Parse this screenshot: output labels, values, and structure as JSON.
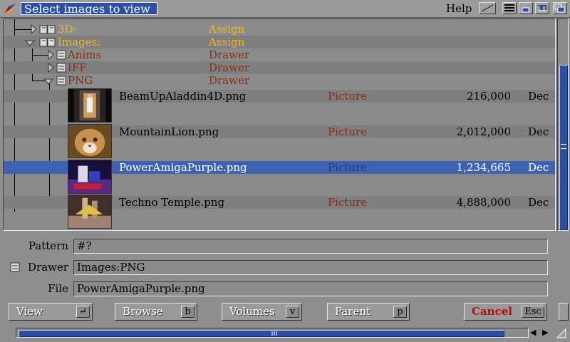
{
  "window": {
    "title": "Select images to view",
    "help_label": "Help"
  },
  "tree": [
    {
      "name": "3D:",
      "type": "Assign",
      "kind": "assign"
    },
    {
      "name": "Images:",
      "type": "Assign",
      "kind": "assign"
    },
    {
      "name": "Anims",
      "type": "Drawer",
      "kind": "drawer"
    },
    {
      "name": "IFF",
      "type": "Drawer",
      "kind": "drawer"
    },
    {
      "name": "PNG",
      "type": "Drawer",
      "kind": "drawer"
    }
  ],
  "files": [
    {
      "name": "BeamUpAladdin4D.png",
      "type": "Picture",
      "size": "216,000",
      "date": "Dec",
      "selected": false,
      "thumb": "thumbnail-beam-up"
    },
    {
      "name": "MountainLion.png",
      "type": "Picture",
      "size": "2,012,000",
      "date": "Dec",
      "selected": false,
      "thumb": "thumbnail-mountain-lion"
    },
    {
      "name": "PowerAmigaPurple.png",
      "type": "Picture",
      "size": "1,234,665",
      "date": "Dec",
      "selected": true,
      "thumb": "thumbnail-power-amiga"
    },
    {
      "name": "Techno Temple.png",
      "type": "Picture",
      "size": "4,888,000",
      "date": "Dec",
      "selected": false,
      "thumb": "thumbnail-techno-temple"
    }
  ],
  "fields": {
    "pattern_label": "Pattern",
    "pattern_value": "#?",
    "drawer_label": "Drawer",
    "drawer_value": "Images:PNG",
    "file_label": "File",
    "file_value": "PowerAmigaPurple.png"
  },
  "buttons": {
    "view": {
      "label": "View",
      "key": "↵"
    },
    "browse": {
      "label": "Browse",
      "key": "b"
    },
    "volumes": {
      "label": "Volumes",
      "key": "v"
    },
    "parent": {
      "label": "Parent",
      "key": "p"
    },
    "cancel": {
      "label": "Cancel",
      "key": "Esc"
    }
  },
  "colors": {
    "accent": "#2c4fa3",
    "assign": "#f3b51f",
    "drawer": "#8a2d0e",
    "selection": "#3f63b3"
  }
}
